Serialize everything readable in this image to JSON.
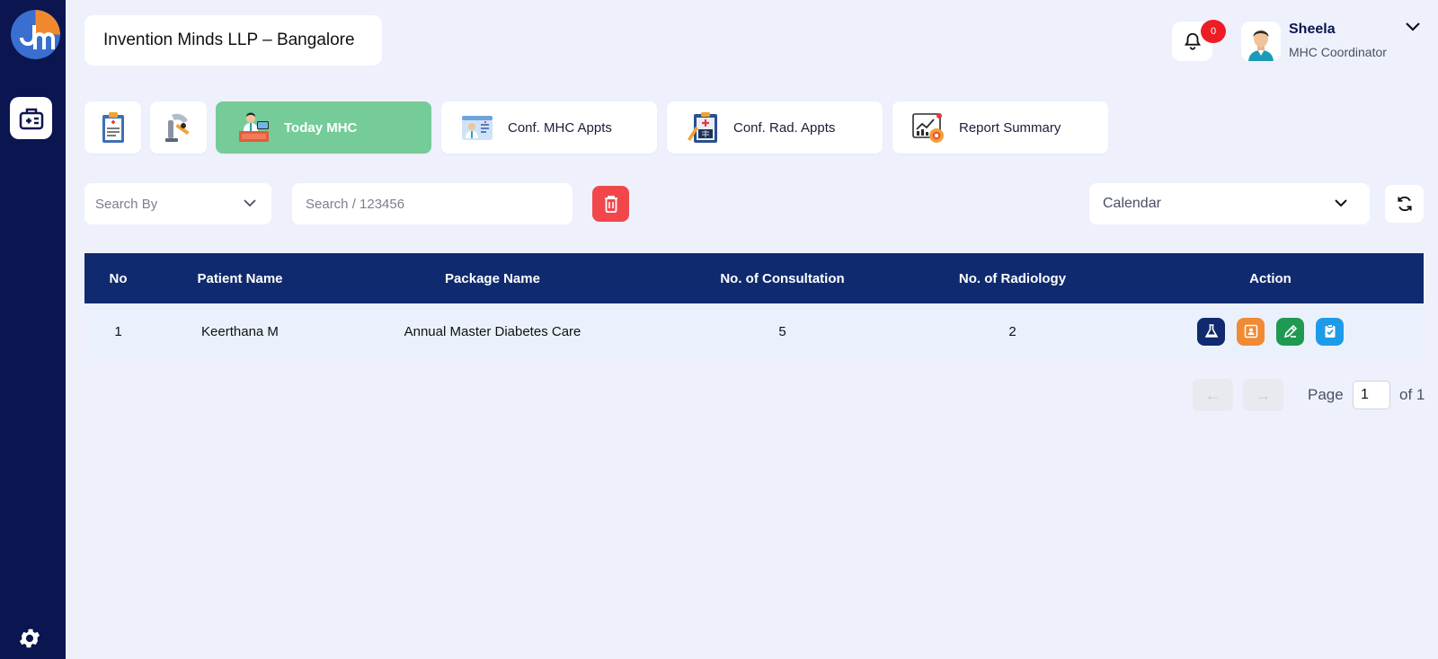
{
  "header": {
    "company": "Invention Minds LLP – Bangalore",
    "notification_count": "0",
    "user_name": "Sheela",
    "user_role": "MHC Coordinator"
  },
  "tabs": [
    {
      "label": "",
      "icon": "clipboard-icon",
      "active": false
    },
    {
      "label": "",
      "icon": "radiology-machine-icon",
      "active": false
    },
    {
      "label": "Today MHC",
      "icon": "doctor-desk-icon",
      "active": true
    },
    {
      "label": "Conf. MHC Appts",
      "icon": "doctor-card-icon",
      "active": false
    },
    {
      "label": "Conf. Rad. Appts",
      "icon": "xray-clipboard-icon",
      "active": false
    },
    {
      "label": "Report Summary",
      "icon": "report-chart-icon",
      "active": false
    }
  ],
  "filters": {
    "search_by": "Search By",
    "search_placeholder": "Search / 123456",
    "calendar": "Calendar"
  },
  "table": {
    "headers": [
      "No",
      "Patient Name",
      "Package Name",
      "No. of Consultation",
      "No. of Radiology",
      "Action"
    ],
    "rows": [
      {
        "no": "1",
        "patient_name": "Keerthana M",
        "package_name": "Annual Master Diabetes Care",
        "consultations": "5",
        "radiology": "2"
      }
    ],
    "actions": [
      {
        "icon": "flask-icon",
        "color": "#0f2a6e"
      },
      {
        "icon": "id-card-icon",
        "color": "#f08a34"
      },
      {
        "icon": "edit-icon",
        "color": "#1e9a52"
      },
      {
        "icon": "clipboard-check-icon",
        "color": "#1e9be8"
      }
    ]
  },
  "pagination": {
    "prev": "←",
    "next": "→",
    "page_label": "Page",
    "current_page": "1",
    "total_label": "of 1"
  },
  "colors": {
    "sidebar": "#0b1550",
    "active_tab": "#75cc98",
    "table_header": "#0f2a6e",
    "delete": "#f1474b",
    "badge": "#ee1c25"
  }
}
